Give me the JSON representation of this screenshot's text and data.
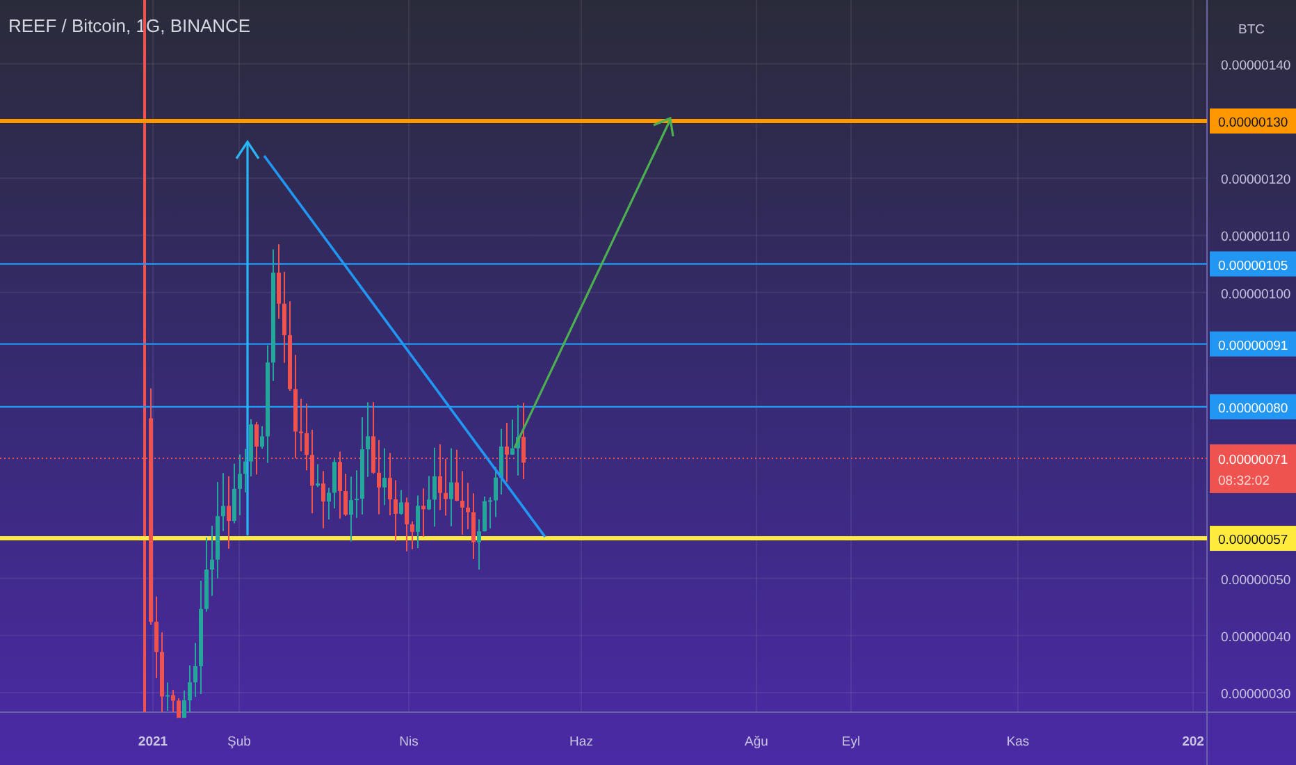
{
  "chart": {
    "title": "REEF / Bitcoin, 1G, BINANCE",
    "currency": "BTC",
    "price_ticks": [
      "0.00000140",
      "0.00000120",
      "0.00000110",
      "0.00000100",
      "0.00000050",
      "0.00000040",
      "0.00000030"
    ],
    "levels": [
      {
        "label": "0.00000130",
        "color": "#ff9800",
        "kind": "major"
      },
      {
        "label": "0.00000105",
        "color": "#2196f3",
        "kind": "minor"
      },
      {
        "label": "0.00000091",
        "color": "#2196f3",
        "kind": "minor"
      },
      {
        "label": "0.00000080",
        "color": "#2196f3",
        "kind": "minor"
      },
      {
        "label": "0.00000057",
        "color": "#ffeb3b",
        "kind": "major"
      }
    ],
    "last_price": {
      "label": "0.00000071",
      "countdown": "08:32:02"
    },
    "time_labels": [
      {
        "label": "2021",
        "bold": true
      },
      {
        "label": "Şub",
        "bold": false
      },
      {
        "label": "Nis",
        "bold": false
      },
      {
        "label": "Haz",
        "bold": false
      },
      {
        "label": "Ağu",
        "bold": false
      },
      {
        "label": "Eyl",
        "bold": false
      },
      {
        "label": "Kas",
        "bold": false
      },
      {
        "label": "202",
        "bold": true
      }
    ]
  }
}
